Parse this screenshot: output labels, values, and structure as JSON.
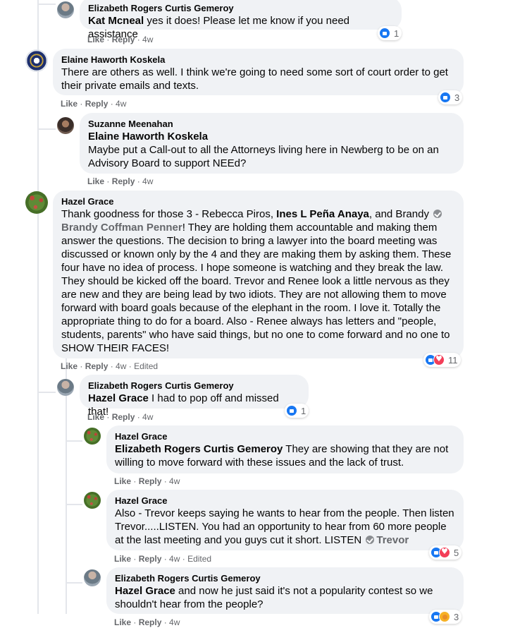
{
  "comments": [
    {
      "author": "Elizabeth Rogers Curtis Gemeroy",
      "mention": "Kat Mcneal",
      "text": " yes it does! Please let me know if you need assistance",
      "actions": {
        "like": "Like",
        "reply": "Reply",
        "time": "4w"
      },
      "reactions": {
        "types": [
          "like"
        ],
        "count": "1"
      }
    },
    {
      "author": "Elaine Haworth Koskela",
      "text": "There are others as well. I think we're going to need some sort of court order to get their private emails and texts.",
      "actions": {
        "like": "Like",
        "reply": "Reply",
        "time": "4w"
      },
      "reactions": {
        "types": [
          "like"
        ],
        "count": "3"
      }
    },
    {
      "author": "Suzanne Meenahan",
      "mention": "Elaine Haworth Koskela",
      "text": "Maybe put a Call-out to all the Attorneys living here in Newberg to be on an Advisory Board to support NEEd?",
      "actions": {
        "like": "Like",
        "reply": "Reply",
        "time": "4w"
      }
    },
    {
      "author": "Hazel Grace",
      "text_a": "Thank goodness for those 3 - Rebecca Piros, ",
      "mention_a": "Ines L Peña Anaya",
      "text_b": ", and Brandy ",
      "mention_b": "Brandy Coffman Penner",
      "text_c": "! They are holding them accountable and making them answer the questions. The decision to bring a lawyer into the board meeting was discussed or known only by the 4 and they are making them by asking them. These four have no idea of process. I hope someone is watching and they break the law. They should be kicked off the board. Trevor and Renee look a little nervous as they are new and they are being lead by two idiots. They are not allowing them to move forward with board goals because of the elephant in the room. I love it. Totally the appropriate thing to do for a board. Also - Renee always has letters and \"people, students, parents\" who have said things, but no one to come forward and no one to SHOW THEIR FACES!",
      "actions": {
        "like": "Like",
        "reply": "Reply",
        "time": "4w",
        "edited": "Edited"
      },
      "reactions": {
        "types": [
          "like",
          "love"
        ],
        "count": "11"
      }
    },
    {
      "author": "Elizabeth Rogers Curtis Gemeroy",
      "mention": "Hazel Grace",
      "text": " I had to pop off and missed that!",
      "actions": {
        "like": "Like",
        "reply": "Reply",
        "time": "4w"
      },
      "reactions": {
        "types": [
          "like"
        ],
        "count": "1"
      }
    },
    {
      "author": "Hazel Grace",
      "mention": "Elizabeth Rogers Curtis Gemeroy",
      "text": " They are showing that they are not willing to move forward with these issues and the lack of trust.",
      "actions": {
        "like": "Like",
        "reply": "Reply",
        "time": "4w"
      }
    },
    {
      "author": "Hazel Grace",
      "text": "Also - Trevor keeps saying he wants to hear from the people. Then listen Trevor.....LISTEN. You had an opportunity to hear from 60 more people at the last meeting and you guys cut it short. LISTEN ",
      "mention": "Trevor",
      "actions": {
        "like": "Like",
        "reply": "Reply",
        "time": "4w",
        "edited": "Edited"
      },
      "reactions": {
        "types": [
          "like",
          "love"
        ],
        "count": "5"
      }
    },
    {
      "author": "Elizabeth Rogers Curtis Gemeroy",
      "mention": "Hazel Grace",
      "text": " and now he just said it's not a popularity contest so we shouldn't hear from the people?",
      "actions": {
        "like": "Like",
        "reply": "Reply",
        "time": "4w"
      },
      "reactions": {
        "types": [
          "like",
          "care"
        ],
        "count": "3"
      }
    }
  ],
  "separator": " · "
}
